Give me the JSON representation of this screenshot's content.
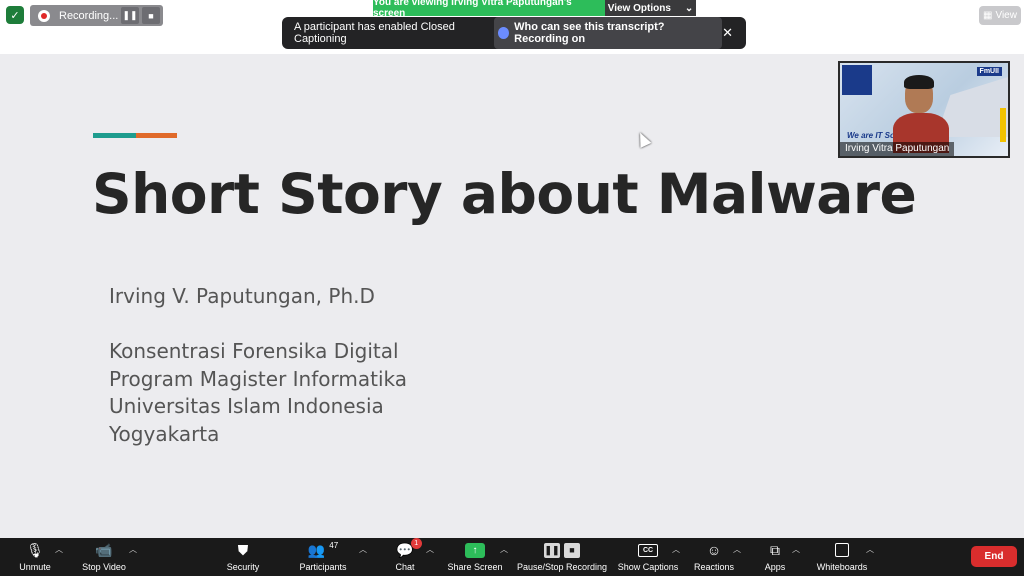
{
  "top": {
    "recording_label": "Recording...",
    "pause_icon": "pause-icon",
    "stop_icon": "stop-icon",
    "viewing_text": "You are viewing Irving Vitra Paputungan's screen",
    "view_options": "View Options",
    "view_button": "View",
    "cc_message": "A participant has enabled Closed Captioning",
    "cc_link": "Who can see this transcript? Recording on",
    "close": "✕"
  },
  "slide": {
    "title": "Short Story about Malware",
    "author": "Irving V. Paputungan, Ph.D",
    "affiliation": [
      "Konsentrasi Forensika Digital",
      "Program Magister Informatika",
      "Universitas Islam Indonesia",
      "Yogyakarta"
    ],
    "accent_colors": [
      "#1e9c8e",
      "#e06a2a"
    ]
  },
  "video": {
    "participant_name": "Irving Vitra Paputungan",
    "brand": "FmUII",
    "slogan": "We are IT Solution"
  },
  "toolbar": {
    "unmute": "Unmute",
    "stop_video": "Stop Video",
    "security": "Security",
    "participants": "Participants",
    "participants_count": "47",
    "chat": "Chat",
    "chat_badge": "1",
    "share_screen": "Share Screen",
    "pause_stop_recording": "Pause/Stop Recording",
    "show_captions": "Show Captions",
    "cc_glyph": "CC",
    "reactions": "Reactions",
    "apps": "Apps",
    "whiteboards": "Whiteboards",
    "end": "End"
  }
}
